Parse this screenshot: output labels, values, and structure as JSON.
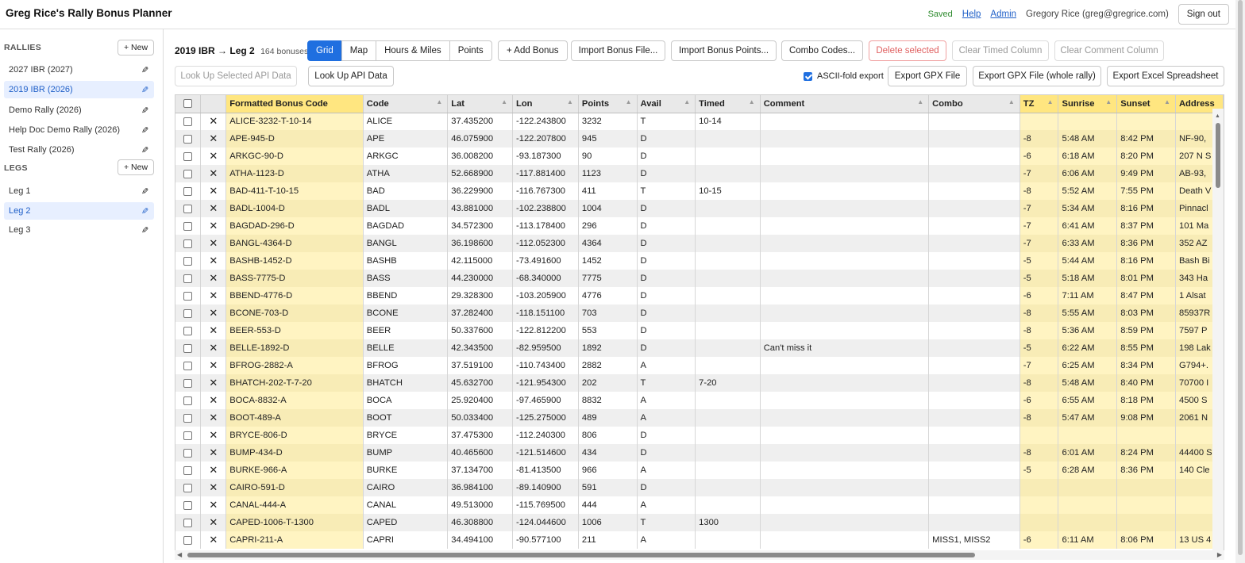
{
  "app": {
    "title": "Greg Rice's Rally Bonus Planner",
    "saved": "Saved",
    "help": "Help",
    "admin": "Admin",
    "user": "Gregory Rice (greg@gregrice.com)",
    "sign_out": "Sign out"
  },
  "sidebar": {
    "rallies_heading": "RALLIES",
    "new_label": "+ New",
    "rallies": [
      {
        "label": "2027 IBR (2027)",
        "active": false
      },
      {
        "label": "2019 IBR (2026)",
        "active": true
      },
      {
        "label": "Demo Rally (2026)",
        "active": false
      },
      {
        "label": "Help Doc Demo Rally (2026)",
        "active": false
      },
      {
        "label": "Test Rally (2026)",
        "active": false
      }
    ],
    "legs_heading": "LEGS",
    "legs": [
      {
        "label": "Leg 1",
        "active": false
      },
      {
        "label": "Leg 2",
        "active": true
      },
      {
        "label": "Leg 3",
        "active": false
      }
    ],
    "edit_icon": "pencil-icon"
  },
  "toolbar": {
    "leg_title": "2019 IBR → Leg 2",
    "bonus_count": "164 bonuses",
    "views": [
      "Grid",
      "Map",
      "Hours & Miles",
      "Points"
    ],
    "active_view": "Grid",
    "add_bonus": "+ Add Bonus",
    "import_file": "Import Bonus File...",
    "import_points": "Import Bonus Points...",
    "combo_codes": "Combo Codes...",
    "delete_selected": "Delete selected",
    "clear_timed": "Clear Timed Column",
    "clear_comment": "Clear Comment Column",
    "lookup_selected": "Look Up Selected API Data",
    "lookup_api": "Look Up API Data",
    "ascii_fold": "ASCII-fold export",
    "ascii_checked": true,
    "export_gpx": "Export GPX File",
    "export_gpx_whole": "Export GPX File (whole rally)",
    "export_excel": "Export Excel Spreadsheet"
  },
  "grid": {
    "columns": [
      "Formatted Bonus Code",
      "Code",
      "Lat",
      "Lon",
      "Points",
      "Avail",
      "Timed",
      "Comment",
      "Combo",
      "TZ",
      "Sunrise",
      "Sunset",
      "Address"
    ],
    "rows": [
      [
        "ALICE-3232-T-10-14",
        "ALICE",
        "37.435200",
        "-122.243800",
        "3232",
        "T",
        "10-14",
        "",
        "",
        "",
        "",
        "",
        ""
      ],
      [
        "APE-945-D",
        "APE",
        "46.075900",
        "-122.207800",
        "945",
        "D",
        "",
        "",
        "",
        "-8",
        "5:48 AM",
        "8:42 PM",
        "NF-90,"
      ],
      [
        "ARKGC-90-D",
        "ARKGC",
        "36.008200",
        "-93.187300",
        "90",
        "D",
        "",
        "",
        "",
        "-6",
        "6:18 AM",
        "8:20 PM",
        "207 N S"
      ],
      [
        "ATHA-1123-D",
        "ATHA",
        "52.668900",
        "-117.881400",
        "1123",
        "D",
        "",
        "",
        "",
        "-7",
        "6:06 AM",
        "9:49 PM",
        "AB-93,"
      ],
      [
        "BAD-411-T-10-15",
        "BAD",
        "36.229900",
        "-116.767300",
        "411",
        "T",
        "10-15",
        "",
        "",
        "-8",
        "5:52 AM",
        "7:55 PM",
        "Death V"
      ],
      [
        "BADL-1004-D",
        "BADL",
        "43.881000",
        "-102.238800",
        "1004",
        "D",
        "",
        "",
        "",
        "-7",
        "5:34 AM",
        "8:16 PM",
        "Pinnacl"
      ],
      [
        "BAGDAD-296-D",
        "BAGDAD",
        "34.572300",
        "-113.178400",
        "296",
        "D",
        "",
        "",
        "",
        "-7",
        "6:41 AM",
        "8:37 PM",
        "101 Ma"
      ],
      [
        "BANGL-4364-D",
        "BANGL",
        "36.198600",
        "-112.052300",
        "4364",
        "D",
        "",
        "",
        "",
        "-7",
        "6:33 AM",
        "8:36 PM",
        "352 AZ"
      ],
      [
        "BASHB-1452-D",
        "BASHB",
        "42.115000",
        "-73.491600",
        "1452",
        "D",
        "",
        "",
        "",
        "-5",
        "5:44 AM",
        "8:16 PM",
        "Bash Bi"
      ],
      [
        "BASS-7775-D",
        "BASS",
        "44.230000",
        "-68.340000",
        "7775",
        "D",
        "",
        "",
        "",
        "-5",
        "5:18 AM",
        "8:01 PM",
        "343 Ha"
      ],
      [
        "BBEND-4776-D",
        "BBEND",
        "29.328300",
        "-103.205900",
        "4776",
        "D",
        "",
        "",
        "",
        "-6",
        "7:11 AM",
        "8:47 PM",
        "1 Alsat"
      ],
      [
        "BCONE-703-D",
        "BCONE",
        "37.282400",
        "-118.151100",
        "703",
        "D",
        "",
        "",
        "",
        "-8",
        "5:55 AM",
        "8:03 PM",
        "85937R"
      ],
      [
        "BEER-553-D",
        "BEER",
        "50.337600",
        "-122.812200",
        "553",
        "D",
        "",
        "",
        "",
        "-8",
        "5:36 AM",
        "8:59 PM",
        "7597 P"
      ],
      [
        "BELLE-1892-D",
        "BELLE",
        "42.343500",
        "-82.959500",
        "1892",
        "D",
        "",
        "Can't miss it",
        "",
        "-5",
        "6:22 AM",
        "8:55 PM",
        "198 Lak"
      ],
      [
        "BFROG-2882-A",
        "BFROG",
        "37.519100",
        "-110.743400",
        "2882",
        "A",
        "",
        "",
        "",
        "-7",
        "6:25 AM",
        "8:34 PM",
        "G794+."
      ],
      [
        "BHATCH-202-T-7-20",
        "BHATCH",
        "45.632700",
        "-121.954300",
        "202",
        "T",
        "7-20",
        "",
        "",
        "-8",
        "5:48 AM",
        "8:40 PM",
        "70700 I"
      ],
      [
        "BOCA-8832-A",
        "BOCA",
        "25.920400",
        "-97.465900",
        "8832",
        "A",
        "",
        "",
        "",
        "-6",
        "6:55 AM",
        "8:18 PM",
        "4500 S"
      ],
      [
        "BOOT-489-A",
        "BOOT",
        "50.033400",
        "-125.275000",
        "489",
        "A",
        "",
        "",
        "",
        "-8",
        "5:47 AM",
        "9:08 PM",
        "2061 N"
      ],
      [
        "BRYCE-806-D",
        "BRYCE",
        "37.475300",
        "-112.240300",
        "806",
        "D",
        "",
        "",
        "",
        "",
        "",
        "",
        ""
      ],
      [
        "BUMP-434-D",
        "BUMP",
        "40.465600",
        "-121.514600",
        "434",
        "D",
        "",
        "",
        "",
        "-8",
        "6:01 AM",
        "8:24 PM",
        "44400 S"
      ],
      [
        "BURKE-966-A",
        "BURKE",
        "37.134700",
        "-81.413500",
        "966",
        "A",
        "",
        "",
        "",
        "-5",
        "6:28 AM",
        "8:36 PM",
        "140 Cle"
      ],
      [
        "CAIRO-591-D",
        "CAIRO",
        "36.984100",
        "-89.140900",
        "591",
        "D",
        "",
        "",
        "",
        "",
        "",
        "",
        ""
      ],
      [
        "CANAL-444-A",
        "CANAL",
        "49.513000",
        "-115.769500",
        "444",
        "A",
        "",
        "",
        "",
        "",
        "",
        "",
        ""
      ],
      [
        "CAPED-1006-T-1300",
        "CAPED",
        "46.308800",
        "-124.044600",
        "1006",
        "T",
        "1300",
        "",
        "",
        "",
        "",
        "",
        ""
      ],
      [
        "CAPRI-211-A",
        "CAPRI",
        "34.494100",
        "-90.577100",
        "211",
        "A",
        "",
        "",
        "MISS1, MISS2",
        "-6",
        "6:11 AM",
        "8:06 PM",
        "13 US 4"
      ]
    ]
  },
  "colors": {
    "accent": "#1f6fe0",
    "highlight_header": "#ffe680",
    "highlight_cell": "#fff4c2",
    "saved": "#2e8b2e",
    "danger": "#e06060"
  }
}
